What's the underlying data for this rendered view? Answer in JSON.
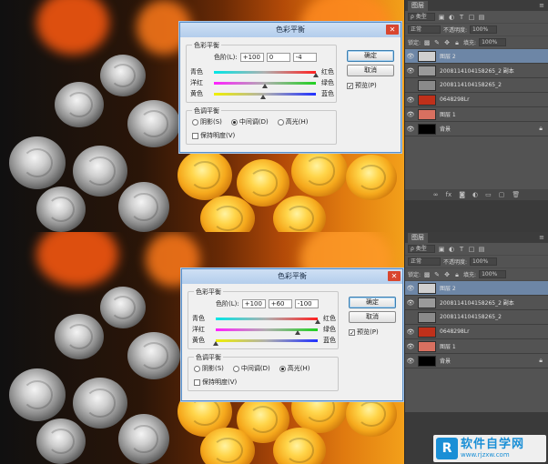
{
  "panels": [
    {
      "dialog": {
        "title": "色彩平衡",
        "group_balance": "色彩平衡",
        "levels_label": "色阶(L):",
        "levels": [
          "+100",
          "0",
          "-4"
        ],
        "sliders": [
          {
            "left": "青色",
            "right": "红色",
            "value": 100
          },
          {
            "left": "洋红",
            "right": "绿色",
            "value": 0
          },
          {
            "left": "黄色",
            "right": "蓝色",
            "value": -4
          }
        ],
        "group_tone": "色调平衡",
        "tones": [
          "阴影(S)",
          "中间调(D)",
          "高光(H)"
        ],
        "selected_tone": 1,
        "preserve_label": "保持明度(V)",
        "preserve_checked": false,
        "ok": "确定",
        "cancel": "取消",
        "preview_label": "预览(P)",
        "preview_checked": true
      }
    },
    {
      "dialog": {
        "title": "色彩平衡",
        "group_balance": "色彩平衡",
        "levels_label": "色阶(L):",
        "levels": [
          "+100",
          "+60",
          "-100"
        ],
        "sliders": [
          {
            "left": "青色",
            "right": "红色",
            "value": 100
          },
          {
            "left": "洋红",
            "right": "绿色",
            "value": 60
          },
          {
            "left": "黄色",
            "right": "蓝色",
            "value": -100
          }
        ],
        "group_tone": "色调平衡",
        "tones": [
          "阴影(S)",
          "中间调(D)",
          "高光(H)"
        ],
        "selected_tone": 2,
        "preserve_label": "保持明度(V)",
        "preserve_checked": false,
        "ok": "确定",
        "cancel": "取消",
        "preview_label": "预览(P)",
        "preview_checked": true
      }
    }
  ],
  "layers_panel": {
    "tab": "图层",
    "kind_label": "ρ 类型",
    "mode": "正常",
    "opacity_label": "不透明度:",
    "opacity": "100%",
    "lock_label": "锁定:",
    "fill_label": "填充:",
    "fill": "100%",
    "layers": [
      {
        "name": "图层 2",
        "thumb": "#cfcfcf",
        "active": true,
        "visible": true
      },
      {
        "name": "20081141041582​65_2 副本",
        "thumb": "#9a9a9a",
        "active": false,
        "visible": true
      },
      {
        "name": "20081141041582​65_2",
        "thumb": "#8a8a8a",
        "active": false,
        "visible": false
      },
      {
        "name": "0648298Lr",
        "thumb": "#c0301a",
        "active": false,
        "visible": true
      },
      {
        "name": "图层 1",
        "thumb": "#d87060",
        "active": false,
        "visible": true
      },
      {
        "name": "背景",
        "thumb": "#000000",
        "active": false,
        "visible": true,
        "locked": true
      }
    ]
  },
  "watermark": {
    "logo": "R",
    "title": "软件自学网",
    "url": "www.rjzxw.com"
  }
}
